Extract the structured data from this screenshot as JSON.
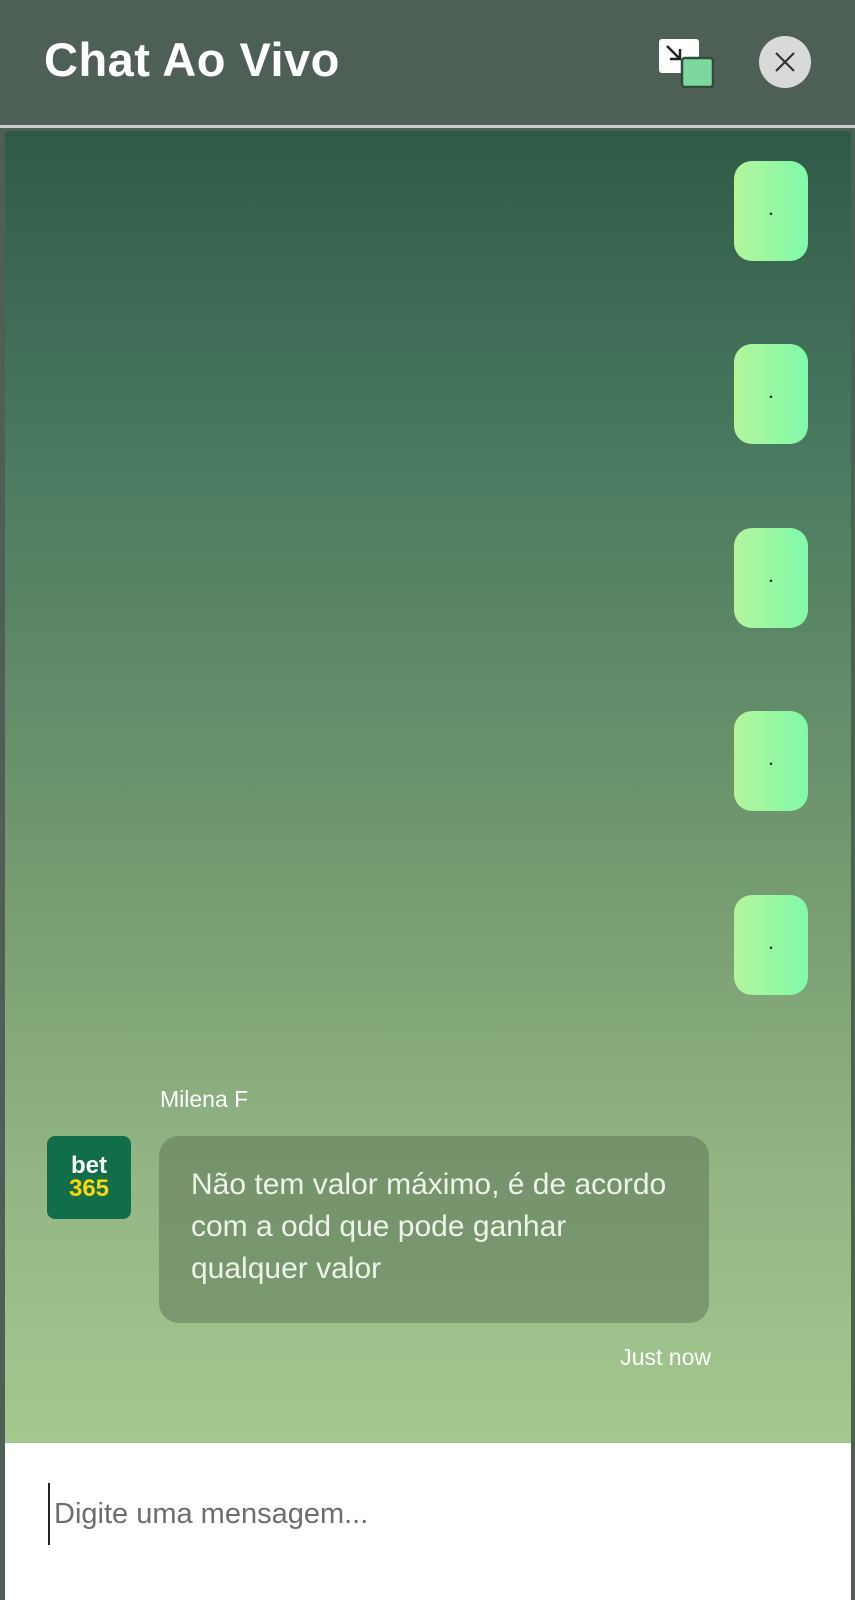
{
  "header": {
    "title": "Chat Ao Vivo",
    "popout_icon": "picture-in-picture-icon",
    "close_icon": "close-icon"
  },
  "chat": {
    "quick_replies": [
      {
        "label": "."
      },
      {
        "label": "."
      },
      {
        "label": "."
      },
      {
        "label": "."
      },
      {
        "label": "."
      }
    ],
    "message": {
      "sender": "Milena F",
      "avatar_line1": "bet",
      "avatar_line2": "365",
      "text": "Não tem valor máximo, é de acordo com a odd que pode ganhar qualquer valor",
      "timestamp": "Just now"
    }
  },
  "input": {
    "placeholder": "Digite uma mensagem..."
  },
  "colors": {
    "header_bg": "#4e5f55",
    "accent_green": "#7ffaa8",
    "brand_green": "#126d4b",
    "brand_yellow": "#ffd700"
  }
}
